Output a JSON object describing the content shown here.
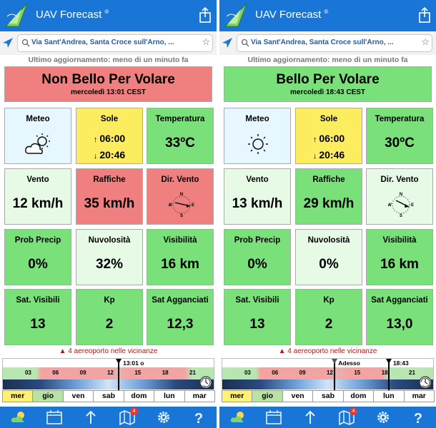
{
  "colors": {
    "header_blue": "#1976d6",
    "pink": "#f08080",
    "green": "#7ae07a",
    "light_green": "#e6fae6",
    "light_blue": "#e6f7ff",
    "yellow": "#fcec5f",
    "warning_red": "#b21717"
  },
  "screens": [
    {
      "app_title": "UAV Forecast",
      "registered_mark": "®",
      "location": "Via Sant'Andrea, Santa Croce sull'Arno, ...",
      "last_update": "Ultimo aggiornamento: meno di un minuto fa",
      "status": {
        "title": "Non Bello Per Volare",
        "date": "mercoledì 13:01 CEST",
        "color": "pink"
      },
      "tiles": {
        "meteo": {
          "label": "Meteo",
          "icon": "partly-cloudy-icon",
          "color": "lightblue"
        },
        "sole": {
          "label": "Sole",
          "sunrise": "06:00",
          "sunset": "20:46",
          "color": "yellow"
        },
        "temperatura": {
          "label": "Temperatura",
          "value": "33ºC",
          "color": "green"
        },
        "vento": {
          "label": "Vento",
          "value": "12 km/h",
          "color": "lightgreen"
        },
        "raffiche": {
          "label": "Raffiche",
          "value": "35 km/h",
          "color": "pink"
        },
        "dir_vento": {
          "label": "Dir. Vento",
          "icon": "compass-icon",
          "color": "pink",
          "compass": {
            "n": "N",
            "s": "S",
            "e": "E",
            "w": "W"
          }
        },
        "prob_precip": {
          "label": "Prob Precip",
          "value": "0%",
          "color": "green"
        },
        "nuvolosita": {
          "label": "Nuvolosità",
          "value": "32%",
          "color": "lightgreen"
        },
        "visibilita": {
          "label": "Visibilità",
          "value": "16 km",
          "color": "green"
        },
        "sat_visibili": {
          "label": "Sat. Visibili",
          "value": "13",
          "color": "green"
        },
        "kp": {
          "label": "Kp",
          "value": "2",
          "color": "green"
        },
        "sat_agganciati": {
          "label": "Sat Agganciati",
          "value": "12,3",
          "color": "green"
        }
      },
      "airport_warning": "4 aereoporto nelle vicinanze",
      "timeline": {
        "hours": [
          "03",
          "06",
          "09",
          "12",
          "15",
          "18",
          "21"
        ],
        "current_label": "13:01 o"
      },
      "days": [
        {
          "label": "mer",
          "state": "active"
        },
        {
          "label": "gio",
          "state": "green"
        },
        {
          "label": "ven",
          "state": ""
        },
        {
          "label": "sab",
          "state": ""
        },
        {
          "label": "dom",
          "state": ""
        },
        {
          "label": "lun",
          "state": ""
        },
        {
          "label": "mar",
          "state": ""
        }
      ],
      "tabbar": {
        "map_badge": "4"
      }
    },
    {
      "app_title": "UAV Forecast",
      "registered_mark": "®",
      "location": "Via Sant'Andrea, Santa Croce sull'Arno, ...",
      "last_update": "Ultimo aggiornamento: meno di un minuto fa",
      "status": {
        "title": "Bello Per Volare",
        "date": "mercoledì 18:43 CEST",
        "color": "green"
      },
      "tiles": {
        "meteo": {
          "label": "Meteo",
          "icon": "sun-icon",
          "color": "lightblue"
        },
        "sole": {
          "label": "Sole",
          "sunrise": "06:00",
          "sunset": "20:46",
          "color": "yellow"
        },
        "temperatura": {
          "label": "Temperatura",
          "value": "30ºC",
          "color": "green"
        },
        "vento": {
          "label": "Vento",
          "value": "13 km/h",
          "color": "lightgreen"
        },
        "raffiche": {
          "label": "Raffiche",
          "value": "29 km/h",
          "color": "green"
        },
        "dir_vento": {
          "label": "Dir. Vento",
          "icon": "compass-icon",
          "color": "lightgreen",
          "compass": {
            "n": "N",
            "s": "S",
            "e": "E",
            "w": "W"
          }
        },
        "prob_precip": {
          "label": "Prob Precip",
          "value": "0%",
          "color": "green"
        },
        "nuvolosita": {
          "label": "Nuvolosità",
          "value": "0%",
          "color": "lightgreen"
        },
        "visibilita": {
          "label": "Visibilità",
          "value": "16 km",
          "color": "green"
        },
        "sat_visibili": {
          "label": "Sat. Visibili",
          "value": "13",
          "color": "green"
        },
        "kp": {
          "label": "Kp",
          "value": "2",
          "color": "green"
        },
        "sat_agganciati": {
          "label": "Sat Agganciati",
          "value": "13,0",
          "color": "green"
        }
      },
      "airport_warning": "4 aereoporto nelle vicinanze",
      "timeline": {
        "hours": [
          "03",
          "06",
          "09",
          "12",
          "15",
          "18",
          "21"
        ],
        "now_label": "Adesso",
        "current_label": "18:43"
      },
      "days": [
        {
          "label": "mer",
          "state": "active"
        },
        {
          "label": "gio",
          "state": "green"
        },
        {
          "label": "ven",
          "state": ""
        },
        {
          "label": "sab",
          "state": ""
        },
        {
          "label": "dom",
          "state": ""
        },
        {
          "label": "lun",
          "state": ""
        },
        {
          "label": "mar",
          "state": ""
        }
      ],
      "tabbar": {
        "map_badge": "4"
      }
    }
  ]
}
